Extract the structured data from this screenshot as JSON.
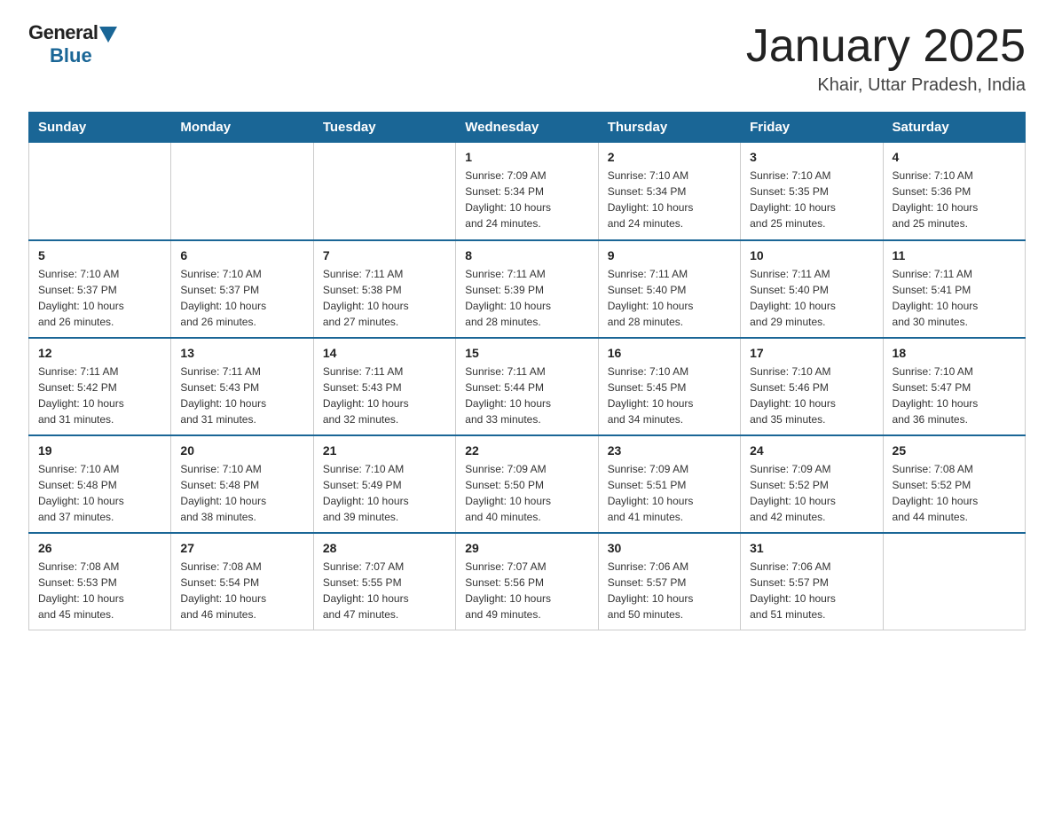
{
  "logo": {
    "general": "General",
    "blue": "Blue"
  },
  "title": "January 2025",
  "subtitle": "Khair, Uttar Pradesh, India",
  "headers": [
    "Sunday",
    "Monday",
    "Tuesday",
    "Wednesday",
    "Thursday",
    "Friday",
    "Saturday"
  ],
  "weeks": [
    [
      {
        "day": "",
        "info": ""
      },
      {
        "day": "",
        "info": ""
      },
      {
        "day": "",
        "info": ""
      },
      {
        "day": "1",
        "info": "Sunrise: 7:09 AM\nSunset: 5:34 PM\nDaylight: 10 hours\nand 24 minutes."
      },
      {
        "day": "2",
        "info": "Sunrise: 7:10 AM\nSunset: 5:34 PM\nDaylight: 10 hours\nand 24 minutes."
      },
      {
        "day": "3",
        "info": "Sunrise: 7:10 AM\nSunset: 5:35 PM\nDaylight: 10 hours\nand 25 minutes."
      },
      {
        "day": "4",
        "info": "Sunrise: 7:10 AM\nSunset: 5:36 PM\nDaylight: 10 hours\nand 25 minutes."
      }
    ],
    [
      {
        "day": "5",
        "info": "Sunrise: 7:10 AM\nSunset: 5:37 PM\nDaylight: 10 hours\nand 26 minutes."
      },
      {
        "day": "6",
        "info": "Sunrise: 7:10 AM\nSunset: 5:37 PM\nDaylight: 10 hours\nand 26 minutes."
      },
      {
        "day": "7",
        "info": "Sunrise: 7:11 AM\nSunset: 5:38 PM\nDaylight: 10 hours\nand 27 minutes."
      },
      {
        "day": "8",
        "info": "Sunrise: 7:11 AM\nSunset: 5:39 PM\nDaylight: 10 hours\nand 28 minutes."
      },
      {
        "day": "9",
        "info": "Sunrise: 7:11 AM\nSunset: 5:40 PM\nDaylight: 10 hours\nand 28 minutes."
      },
      {
        "day": "10",
        "info": "Sunrise: 7:11 AM\nSunset: 5:40 PM\nDaylight: 10 hours\nand 29 minutes."
      },
      {
        "day": "11",
        "info": "Sunrise: 7:11 AM\nSunset: 5:41 PM\nDaylight: 10 hours\nand 30 minutes."
      }
    ],
    [
      {
        "day": "12",
        "info": "Sunrise: 7:11 AM\nSunset: 5:42 PM\nDaylight: 10 hours\nand 31 minutes."
      },
      {
        "day": "13",
        "info": "Sunrise: 7:11 AM\nSunset: 5:43 PM\nDaylight: 10 hours\nand 31 minutes."
      },
      {
        "day": "14",
        "info": "Sunrise: 7:11 AM\nSunset: 5:43 PM\nDaylight: 10 hours\nand 32 minutes."
      },
      {
        "day": "15",
        "info": "Sunrise: 7:11 AM\nSunset: 5:44 PM\nDaylight: 10 hours\nand 33 minutes."
      },
      {
        "day": "16",
        "info": "Sunrise: 7:10 AM\nSunset: 5:45 PM\nDaylight: 10 hours\nand 34 minutes."
      },
      {
        "day": "17",
        "info": "Sunrise: 7:10 AM\nSunset: 5:46 PM\nDaylight: 10 hours\nand 35 minutes."
      },
      {
        "day": "18",
        "info": "Sunrise: 7:10 AM\nSunset: 5:47 PM\nDaylight: 10 hours\nand 36 minutes."
      }
    ],
    [
      {
        "day": "19",
        "info": "Sunrise: 7:10 AM\nSunset: 5:48 PM\nDaylight: 10 hours\nand 37 minutes."
      },
      {
        "day": "20",
        "info": "Sunrise: 7:10 AM\nSunset: 5:48 PM\nDaylight: 10 hours\nand 38 minutes."
      },
      {
        "day": "21",
        "info": "Sunrise: 7:10 AM\nSunset: 5:49 PM\nDaylight: 10 hours\nand 39 minutes."
      },
      {
        "day": "22",
        "info": "Sunrise: 7:09 AM\nSunset: 5:50 PM\nDaylight: 10 hours\nand 40 minutes."
      },
      {
        "day": "23",
        "info": "Sunrise: 7:09 AM\nSunset: 5:51 PM\nDaylight: 10 hours\nand 41 minutes."
      },
      {
        "day": "24",
        "info": "Sunrise: 7:09 AM\nSunset: 5:52 PM\nDaylight: 10 hours\nand 42 minutes."
      },
      {
        "day": "25",
        "info": "Sunrise: 7:08 AM\nSunset: 5:52 PM\nDaylight: 10 hours\nand 44 minutes."
      }
    ],
    [
      {
        "day": "26",
        "info": "Sunrise: 7:08 AM\nSunset: 5:53 PM\nDaylight: 10 hours\nand 45 minutes."
      },
      {
        "day": "27",
        "info": "Sunrise: 7:08 AM\nSunset: 5:54 PM\nDaylight: 10 hours\nand 46 minutes."
      },
      {
        "day": "28",
        "info": "Sunrise: 7:07 AM\nSunset: 5:55 PM\nDaylight: 10 hours\nand 47 minutes."
      },
      {
        "day": "29",
        "info": "Sunrise: 7:07 AM\nSunset: 5:56 PM\nDaylight: 10 hours\nand 49 minutes."
      },
      {
        "day": "30",
        "info": "Sunrise: 7:06 AM\nSunset: 5:57 PM\nDaylight: 10 hours\nand 50 minutes."
      },
      {
        "day": "31",
        "info": "Sunrise: 7:06 AM\nSunset: 5:57 PM\nDaylight: 10 hours\nand 51 minutes."
      },
      {
        "day": "",
        "info": ""
      }
    ]
  ]
}
